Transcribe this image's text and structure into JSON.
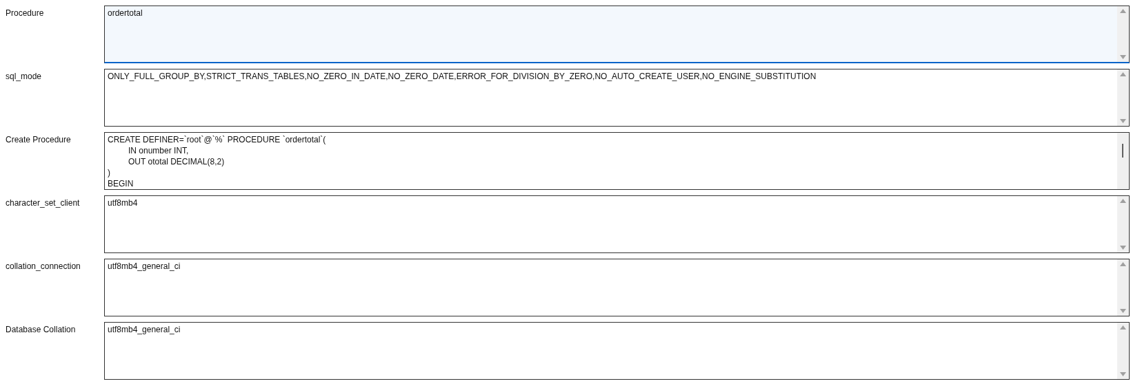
{
  "fields": [
    {
      "label": "Procedure",
      "lines": [
        "ordertotal"
      ],
      "focused": true,
      "kind": "short"
    },
    {
      "label": "sql_mode",
      "lines": [
        "ONLY_FULL_GROUP_BY,STRICT_TRANS_TABLES,NO_ZERO_IN_DATE,NO_ZERO_DATE,ERROR_FOR_DIVISION_BY_ZERO,NO_AUTO_CREATE_USER,NO_ENGINE_SUBSTITUTION"
      ],
      "focused": false,
      "kind": "short"
    },
    {
      "label": "Create Procedure",
      "lines": [
        "CREATE DEFINER=`root`@`%` PROCEDURE `ordertotal`(",
        "\tIN onumber INT,",
        "\tOUT ototal DECIMAL(8,2)",
        ")",
        "BEGIN"
      ],
      "focused": false,
      "kind": "long"
    },
    {
      "label": "character_set_client",
      "lines": [
        "utf8mb4"
      ],
      "focused": false,
      "kind": "short"
    },
    {
      "label": "collation_connection",
      "lines": [
        "utf8mb4_general_ci"
      ],
      "focused": false,
      "kind": "short"
    },
    {
      "label": "Database Collation",
      "lines": [
        "utf8mb4_general_ci"
      ],
      "focused": false,
      "kind": "short"
    }
  ]
}
